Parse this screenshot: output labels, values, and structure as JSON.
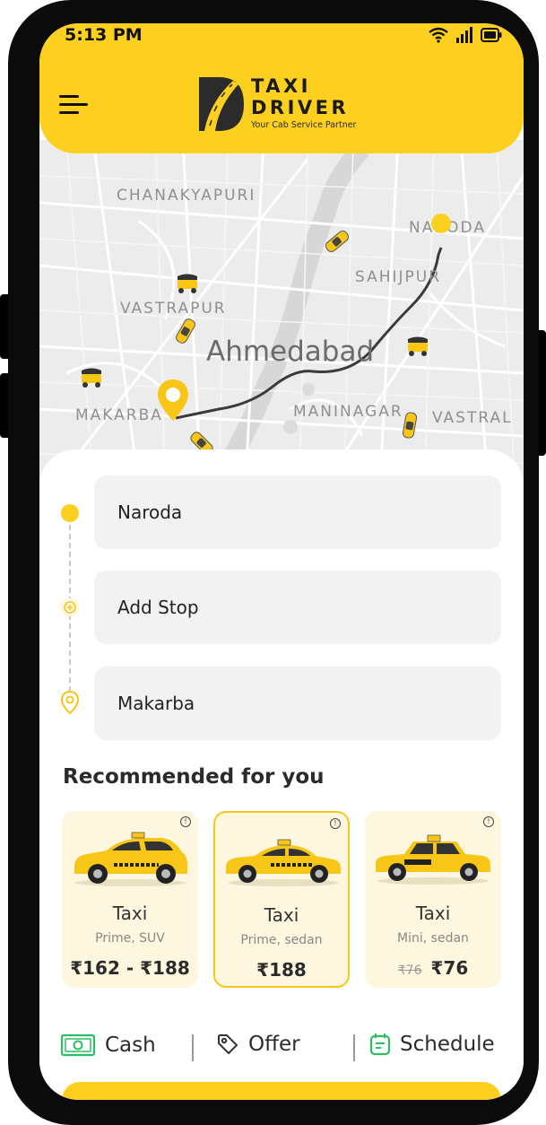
{
  "status": {
    "time": "5:13 PM"
  },
  "header": {
    "logo_line1": "TAXI",
    "logo_line2": "DRIVER",
    "tagline": "Your Cab Service Partner"
  },
  "map": {
    "city": "Ahmedabad",
    "areas": {
      "chanakyapuri": "CHANAKYAPURI",
      "naroda": "NARODA",
      "sahijpur": "SAHIJPUR",
      "vastrapur": "VASTRAPUR",
      "makarba": "MAKARBA",
      "maninagar": "MANINAGAR",
      "vastral": "VASTRAL"
    }
  },
  "route": {
    "pickup": "Naroda",
    "stop": "Add Stop",
    "destination": "Makarba"
  },
  "recommended": {
    "title": "Recommended for you",
    "cards": [
      {
        "name": "Taxi",
        "type": "Prime, SUV",
        "price": "₹162 - ₹188",
        "old_price": "",
        "selected": false
      },
      {
        "name": "Taxi",
        "type": "Prime, sedan",
        "price": "₹188",
        "old_price": "",
        "selected": true
      },
      {
        "name": "Taxi",
        "type": "Mini, sedan",
        "price": "₹76",
        "old_price": "₹76",
        "selected": false
      }
    ]
  },
  "options": {
    "cash": "Cash",
    "offer": "Offer",
    "schedule": "Schedule"
  },
  "colors": {
    "accent": "#FDD01F",
    "card_bg": "#FEF7DF",
    "map_bg": "#ECECEC",
    "schedule_icon": "#2DBE63"
  },
  "icons": [
    "menu-icon",
    "wifi-icon",
    "signal-icon",
    "battery-icon",
    "taxi-icon",
    "auto-rickshaw-icon",
    "location-pin-icon",
    "add-circle-icon",
    "info-icon",
    "cash-icon",
    "tag-icon",
    "calendar-icon"
  ]
}
